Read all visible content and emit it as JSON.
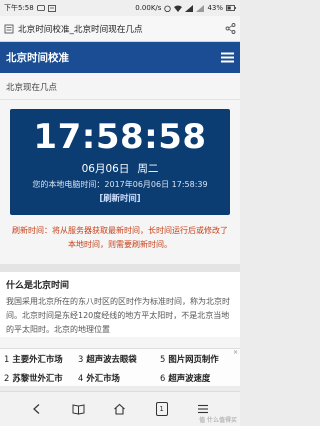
{
  "status_bar": {
    "time": "下午5:58",
    "speed": "0.00K/s",
    "battery": "43%"
  },
  "browser": {
    "url_title": "北京时间校准_北京时间现在几点",
    "tab_count": "1"
  },
  "header": {
    "site_title": "北京时间校准"
  },
  "main": {
    "subtitle": "北京现在几点",
    "clock": {
      "time": "17:58:58",
      "date": "06月06日",
      "weekday": "周二",
      "local_time": "您的本地电脑时间：2017年06月06日 17:58:39",
      "refresh_label": "[刷新时间]"
    },
    "note": "刷新时间：将从服务器获取最新时间，长时间运行后或修改了本地时间，则需要刷新时间。",
    "section": {
      "title": "什么是北京时间",
      "body": "我国采用北京所在的东八时区的区时作为标准时间，称为北京时间。北京时间是东经120度经线的地方平太阳时，不是北京当地的平太阳时。北京的地理位置"
    }
  },
  "ads": {
    "row1": [
      {
        "num": "1",
        "label": "主要外汇市场"
      },
      {
        "num": "3",
        "label": "超声波去眼袋"
      },
      {
        "num": "5",
        "label": "图片网页制作"
      }
    ],
    "row2": [
      {
        "num": "2",
        "label": "苏黎世外汇市"
      },
      {
        "num": "4",
        "label": "外汇市场"
      },
      {
        "num": "6",
        "label": "超声波速度"
      }
    ]
  },
  "watermark": "值 什么值得买",
  "colors": {
    "header_blue": "#1a4d93",
    "clock_blue": "#0b3c72",
    "note_red": "#c7411b"
  }
}
